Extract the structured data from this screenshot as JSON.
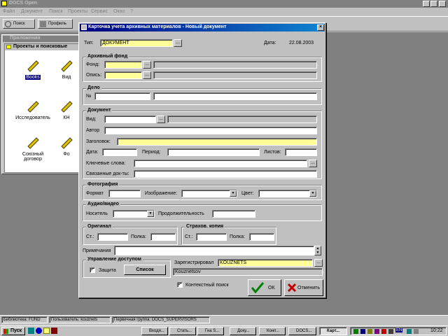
{
  "app": {
    "title": "DOCS Open",
    "menu": [
      "Файл",
      "Документ",
      "Поиск",
      "Проекты",
      "Сервис",
      "Окно",
      "?"
    ],
    "toolbar": [
      "Поиск",
      "Профиль"
    ]
  },
  "bg_window": {
    "title": "Приложения",
    "inner_title": "Проекты и поисковые",
    "icons": [
      {
        "label": "Books",
        "icon": "key-icon"
      },
      {
        "label": "Вид",
        "icon": "key-icon"
      },
      {
        "label": "Исследователь",
        "icon": "key-icon"
      },
      {
        "label": "КН",
        "icon": "key-icon"
      },
      {
        "label": "Союзный договор",
        "icon": "key-icon"
      },
      {
        "label": "Фо",
        "icon": "key-icon"
      }
    ]
  },
  "dialog": {
    "title": "Карточка учета архивных материалов - Новый документ",
    "type_label": "Тип:",
    "type_value": "ДОКУМЕНТ",
    "date_label": "Дата:",
    "date_value": "22.08.2003",
    "arch": {
      "title": "Архивный фонд",
      "fond_label": "Фонд:",
      "opis_label": "Опись:"
    },
    "delo": {
      "title": "Дело",
      "num_label": "№"
    },
    "doc": {
      "title": "Документ",
      "vid": "Вид:",
      "author": "Автор",
      "heading": "Заголовок:",
      "date": "Дата:",
      "period": "Период:",
      "sheets": "Листов:",
      "keywords": "Ключевые слова:",
      "related": "Связанные док-ты:"
    },
    "photo": {
      "title": "Фотография",
      "format": "Формат",
      "image": "Изображение:",
      "color": "Цвет:"
    },
    "av": {
      "title": "Аудио/видео",
      "carrier": "Носитель",
      "duration": "Продолжительность"
    },
    "original": {
      "title": "Оригинал",
      "st": "Ст.:",
      "shelf": "Полка:"
    },
    "insurance": {
      "title": "Страхов. копия",
      "st": "Ст.:",
      "shelf": "Полка:"
    },
    "notes_label": "Примечания",
    "access": {
      "title": "Управление доступом",
      "protect_label": "Защита",
      "protect_checked": true,
      "list_button": "Список"
    },
    "registered_label": "Зарегистрировал",
    "registered_value": "KOUZNETS",
    "registered_name": "Kouznetsov",
    "context_search_label": "Контекстный поиск",
    "context_search_checked": true,
    "ok_label": "ОК",
    "cancel_label": "Отменить"
  },
  "status_bar": [
    "Библиотека: FUND",
    "Пользователь: kouznets",
    "Первичная группа: DOCS_SUPERVISORS"
  ],
  "taskbar": {
    "start": "Пуск",
    "tasks": [
      "Входя...",
      "Стать...",
      "Гна S...",
      "Доку...",
      "Конп...",
      "DOCS...",
      "Карт..."
    ],
    "clock": "10:22",
    "lang": "EN"
  },
  "colors": {
    "titlebar": "#000080",
    "field_highlight": "#ffff99",
    "desktop": "#808080",
    "face": "#c0c0c0"
  }
}
